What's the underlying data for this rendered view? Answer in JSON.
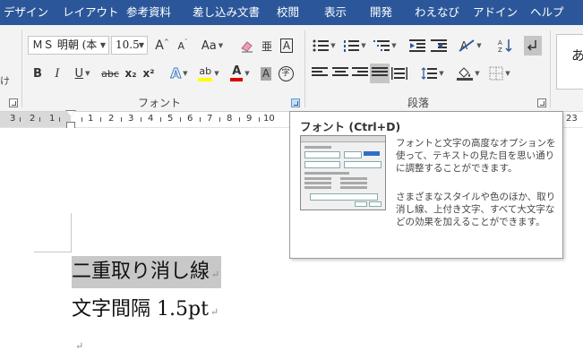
{
  "tabs": [
    "デザイン",
    "レイアウト",
    "参考資料",
    "差し込み文書",
    "校閲",
    "表示",
    "開発",
    "わえなび",
    "アドイン",
    "ヘルプ"
  ],
  "ribbon": {
    "left_edge_char": "け",
    "font_group": {
      "font_name": "ＭＳ 明朝 (本",
      "font_size": "10.5",
      "label": "フォント",
      "grow": "A",
      "shrink": "A",
      "change_case": "Aa",
      "phonetic": "亜",
      "border_char": "A",
      "bold": "B",
      "italic": "I",
      "underline": "U",
      "strike": "abc",
      "subscript": "x₂",
      "superscript": "x²",
      "effects": "A",
      "highlight": "ab",
      "font_color": "A",
      "shading": "A",
      "enclose": "字"
    },
    "para_group": {
      "label": "段落"
    },
    "style_preview": "あ"
  },
  "ruler": {
    "left": [
      "3",
      "2",
      "1"
    ],
    "right": [
      "1",
      "2",
      "3",
      "4",
      "5",
      "6",
      "7",
      "8",
      "9",
      "10",
      "11",
      "12",
      "13",
      "14",
      "15",
      "16",
      "17",
      "18",
      "19",
      "20",
      "21",
      "22",
      "23"
    ]
  },
  "document": {
    "lines": [
      "二重取り消し線",
      "文字間隔 1.5pt"
    ],
    "para_mark": "↵"
  },
  "tooltip": {
    "title": "フォント (Ctrl+D)",
    "p1": "フォントと文字の高度なオプションを使って、テキストの見た目を思い通りに調整することができます。",
    "p2": "さまざまなスタイルや色のほか、取り消し線、上付き文字、すべて大文字などの効果を加えることができます。"
  },
  "colors": {
    "tab_bar": "#2b579a",
    "ribbon_bg": "#f3f3f3",
    "highlight_yellow": "#ffff00",
    "font_color_red": "#e00000",
    "selection_gray": "#c8c8c8"
  }
}
